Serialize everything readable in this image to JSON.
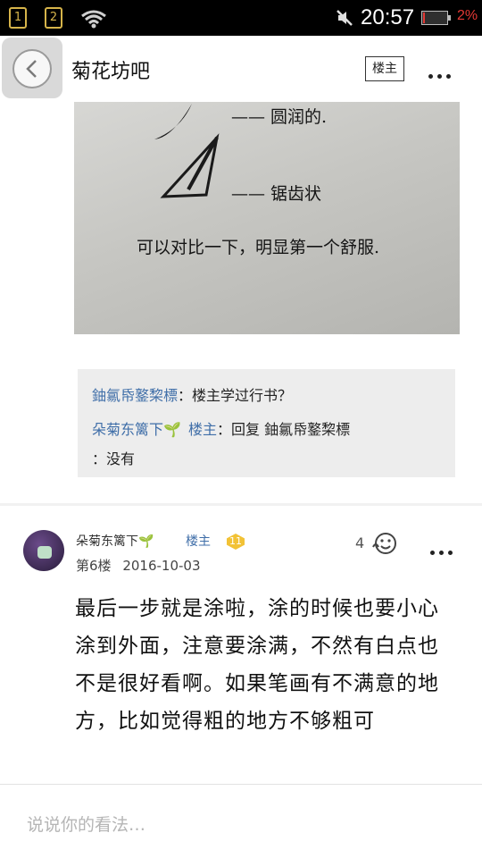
{
  "status_bar": {
    "sim1": "1",
    "sim2": "2",
    "time": "20:57",
    "battery": "2%",
    "battery_color": "#e53935"
  },
  "top_bar": {
    "title": "菊花坊吧",
    "op_button": "楼主",
    "back_icon": "back-arrow-icon",
    "more_icon": "more-dots-icon"
  },
  "post_image": {
    "lines": [
      "—— 圆润的.",
      "—— 锯齿状",
      "可以对比一下，明显第一个舒服."
    ]
  },
  "sub_comments": [
    {
      "author": "鈾氱帋鐜棃標",
      "text": "：楼主学过行书？"
    },
    {
      "author": "朵菊东篱下",
      "sprout": "🌱",
      "op_label": "楼主",
      "reply_prefix": "：回复",
      "reply_to": "鈾氱帋鐜棃標",
      "text": "：没有"
    }
  ],
  "floor": {
    "author": "朵菊东篱下",
    "sprout": "🌱",
    "op_label": "楼主",
    "level": "11",
    "floor_label": "第6楼",
    "date": "2016-10-03",
    "likes": "4",
    "body": "最后一步就是涂啦，涂的时候也要小心涂到外面，注意要涂满，不然有白点也不是很好看啊。如果笔画有不满意的地方，比如觉得粗的地方不够粗可"
  },
  "input": {
    "placeholder": "说说你的看法…"
  }
}
